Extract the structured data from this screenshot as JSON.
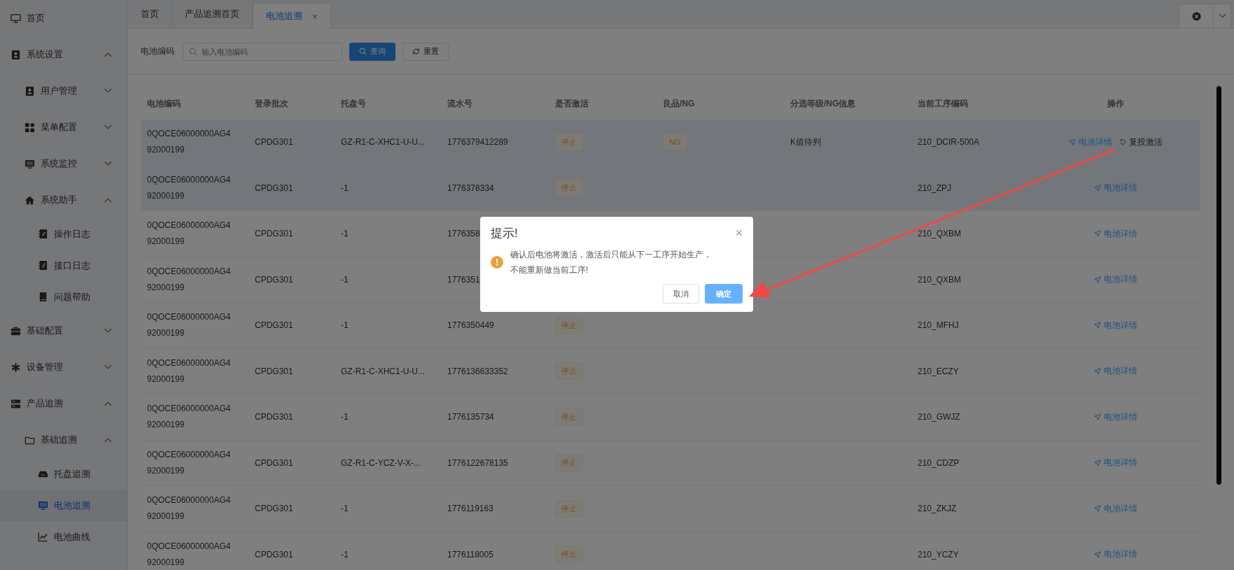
{
  "sidebar": {
    "items": [
      {
        "label": "首页",
        "selected": false
      },
      {
        "label": "系统设置",
        "selected": false,
        "expanded": true,
        "children": [
          {
            "label": "用户管理",
            "selected": false,
            "expanded": false
          },
          {
            "label": "菜单配置",
            "selected": false,
            "expanded": false
          },
          {
            "label": "系统监控",
            "selected": false,
            "expanded": false
          },
          {
            "label": "系统助手",
            "selected": false,
            "expanded": true,
            "children": [
              {
                "label": "操作日志",
                "selected": false
              },
              {
                "label": "接口日志",
                "selected": false
              },
              {
                "label": "问题帮助",
                "selected": false
              }
            ]
          }
        ]
      },
      {
        "label": "基础配置",
        "selected": false,
        "expanded": false
      },
      {
        "label": "设备管理",
        "selected": false,
        "expanded": false
      },
      {
        "label": "产品追溯",
        "selected": false,
        "expanded": true,
        "children": [
          {
            "label": "基础追溯",
            "selected": false,
            "expanded": true,
            "children": [
              {
                "label": "托盘追溯",
                "selected": false
              },
              {
                "label": "电池追溯",
                "selected": true
              },
              {
                "label": "电池曲线",
                "selected": false
              }
            ]
          }
        ]
      }
    ]
  },
  "tabs": [
    {
      "label": "首页",
      "selected": false
    },
    {
      "label": "产品追溯首页",
      "selected": false
    },
    {
      "label": "电池追溯",
      "selected": true,
      "close": "×"
    }
  ],
  "search": {
    "label": "电池编码",
    "placeholder": "输入电池编码",
    "query_button": "查询",
    "reset_button": "重置"
  },
  "table": {
    "columns": [
      "电池编码",
      "登录批次",
      "托盘号",
      "流水号",
      "是否激活",
      "良品/NG",
      "分选等级/NG信息",
      "当前工序编码",
      "操作"
    ],
    "rows": [
      {
        "highlighted": true,
        "code": "0QOCE06000000AG492000199",
        "batch": "CPDG301",
        "tray": "GZ-R1-C-XHC1-U-U...",
        "serial": "1776379412289",
        "status": "停止",
        "quality": "NG",
        "grade": "K值待判",
        "process": "210_DCIR-500A",
        "actions": [
          {
            "kind": "detail",
            "label": "电池详情"
          },
          {
            "kind": "reactivate",
            "label": "复投激活"
          }
        ]
      },
      {
        "highlighted": true,
        "code": "0QOCE06000000AG492000199",
        "batch": "CPDG301",
        "tray": "-1",
        "serial": "1776378334",
        "status": "停止",
        "process": "210_ZPJ",
        "actions": [
          {
            "kind": "detail",
            "label": "电池详情"
          }
        ]
      },
      {
        "highlighted": false,
        "code": "0QOCE06000000AG492000199",
        "batch": "CPDG301",
        "tray": "-1",
        "serial": "1776358",
        "process": "210_QXBM",
        "actions": [
          {
            "kind": "detail",
            "label": "电池详情"
          }
        ]
      },
      {
        "highlighted": false,
        "code": "0QOCE06000000AG492000199",
        "batch": "CPDG301",
        "tray": "-1",
        "serial": "1776351",
        "process": "210_QXBM",
        "actions": [
          {
            "kind": "detail",
            "label": "电池详情"
          }
        ]
      },
      {
        "highlighted": false,
        "code": "0QOCE06000000AG492000199",
        "batch": "CPDG301",
        "tray": "-1",
        "serial": "1776350449",
        "status": "停止",
        "process": "210_MFHJ",
        "actions": [
          {
            "kind": "detail",
            "label": "电池详情"
          }
        ]
      },
      {
        "highlighted": false,
        "code": "0QOCE06000000AG492000199",
        "batch": "CPDG301",
        "tray": "GZ-R1-C-XHC1-U-U...",
        "serial": "1776136633352",
        "status": "停止",
        "process": "210_ECZY",
        "actions": [
          {
            "kind": "detail",
            "label": "电池详情"
          }
        ]
      },
      {
        "highlighted": false,
        "code": "0QOCE06000000AG492000199",
        "batch": "CPDG301",
        "tray": "-1",
        "serial": "1776135734",
        "status": "停止",
        "process": "210_GWJZ",
        "actions": [
          {
            "kind": "detail",
            "label": "电池详情"
          }
        ]
      },
      {
        "highlighted": false,
        "code": "0QOCE06000000AG492000199",
        "batch": "CPDG301",
        "tray": "GZ-R1-C-YCZ-V-X-...",
        "serial": "1776122678135",
        "status": "停止",
        "process": "210_CDZP",
        "actions": [
          {
            "kind": "detail",
            "label": "电池详情"
          }
        ]
      },
      {
        "highlighted": false,
        "code": "0QOCE06000000AG492000199",
        "batch": "CPDG301",
        "tray": "-1",
        "serial": "1776119163",
        "status": "停止",
        "process": "210_ZKJZ",
        "actions": [
          {
            "kind": "detail",
            "label": "电池详情"
          }
        ]
      },
      {
        "highlighted": false,
        "code": "0QOCE06000000AG492000199",
        "batch": "CPDG301",
        "tray": "-1",
        "serial": "1776118005",
        "status": "停止",
        "process": "210_YCZY",
        "actions": [
          {
            "kind": "detail",
            "label": "电池详情"
          }
        ]
      }
    ]
  },
  "dialog": {
    "title": "提示!",
    "close": "×",
    "message": "确认后电池将激活，激活后只能从下一工序开始生产，不能重新做当前工序!",
    "buttons": [
      {
        "kind": "cancel",
        "label": "取消"
      },
      {
        "kind": "confirm",
        "label": "确定"
      }
    ]
  }
}
